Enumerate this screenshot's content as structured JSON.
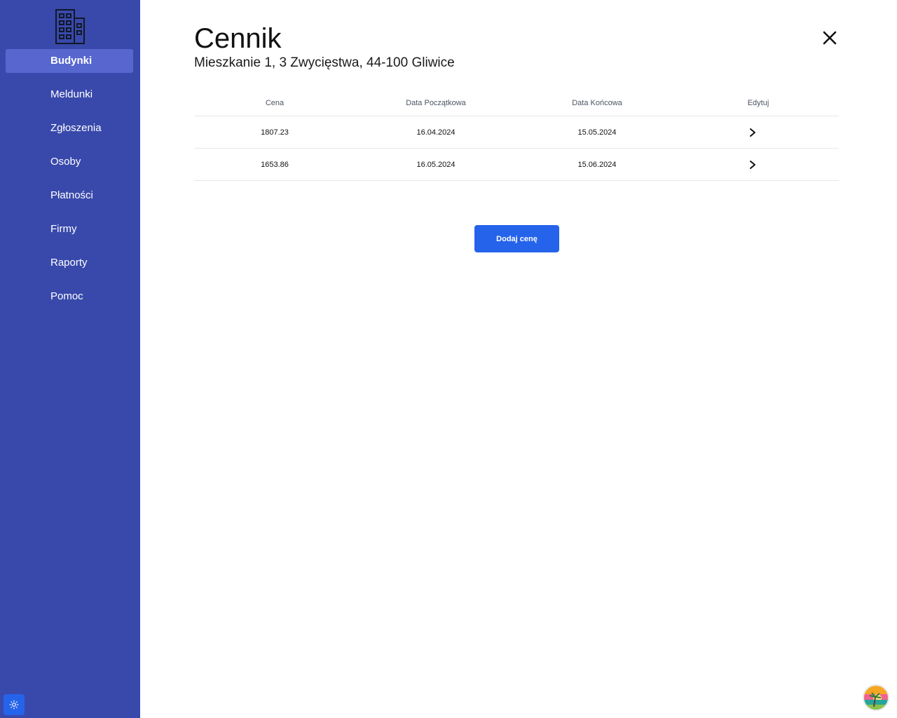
{
  "sidebar": {
    "items": [
      {
        "label": "Budynki",
        "active": true
      },
      {
        "label": "Meldunki"
      },
      {
        "label": "Zgłoszenia"
      },
      {
        "label": "Osoby"
      },
      {
        "label": "Płatności"
      },
      {
        "label": "Firmy"
      },
      {
        "label": "Raporty"
      },
      {
        "label": "Pomoc"
      }
    ],
    "logo_icon": "building-icon",
    "theme_icon": "sun-icon",
    "background_color": "#3949ab",
    "active_color": "#5767cf"
  },
  "page": {
    "title": "Cennik",
    "subtitle": "Mieszkanie 1, 3 Zwycięstwa, 44-100 Gliwice",
    "close_icon": "close-icon"
  },
  "table": {
    "headers": [
      "Cena",
      "Data Początkowa",
      "Data Końcowa",
      "Edytuj"
    ],
    "rows": [
      {
        "price": "1807.23",
        "start": "16.04.2024",
        "end": "15.05.2024"
      },
      {
        "price": "1653.86",
        "start": "16.05.2024",
        "end": "15.06.2024"
      }
    ],
    "edit_icon": "chevron-right-icon"
  },
  "actions": {
    "add_price_label": "Dodaj cenę",
    "button_color": "#2563eb"
  }
}
